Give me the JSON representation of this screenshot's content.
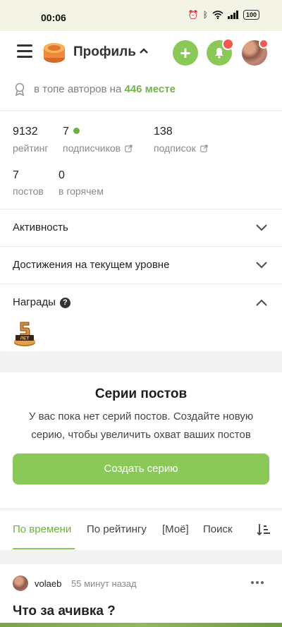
{
  "status_bar": {
    "time": "00:06",
    "battery": "100"
  },
  "header": {
    "title": "Профиль"
  },
  "rank": {
    "prefix": "в топе авторов на",
    "place": "446 месте"
  },
  "stats": [
    {
      "value": "9132",
      "label": "рейтинг"
    },
    {
      "value": "7",
      "label": "подписчиков"
    },
    {
      "value": "138",
      "label": "подписок"
    },
    {
      "value": "7",
      "label": "постов"
    },
    {
      "value": "0",
      "label": "в горячем"
    }
  ],
  "sections": {
    "activity": "Активность",
    "achievements": "Достижения на текущем уровне",
    "awards": "Награды",
    "award_badge_text": "5 ЛЕТ"
  },
  "series": {
    "title": "Серии постов",
    "description": "У вас пока нет серий постов. Создайте новую серию, чтобы увеличить охват ваших постов",
    "button": "Создать серию"
  },
  "tabs": [
    "По времени",
    "По рейтингу",
    "[Моё]",
    "Поиск"
  ],
  "post": {
    "author": "volaeb",
    "time": "55 минут назад",
    "title": "Что за ачивка ?"
  },
  "colors": {
    "accent": "#8ac858",
    "badge_red": "#f2584f"
  }
}
